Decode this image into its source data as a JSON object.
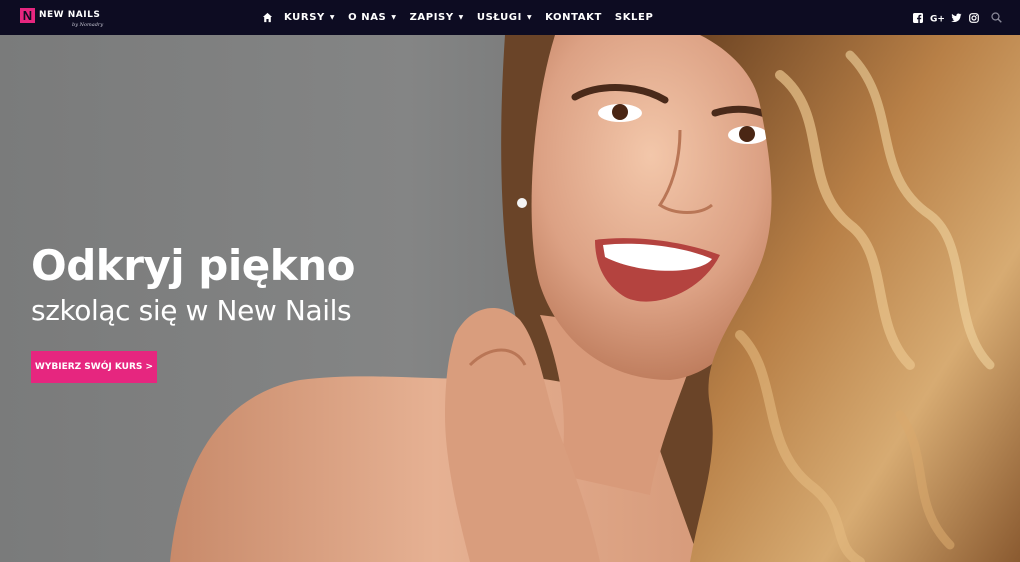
{
  "brand": {
    "logo_letter": "N",
    "name": "NEW NAILS",
    "subtitle": "by Nomadry",
    "accent_color": "#e6267f",
    "nav_background": "#0d0c22"
  },
  "nav": {
    "home_icon": "home-icon",
    "items": [
      {
        "label": "KURSY",
        "dropdown": true
      },
      {
        "label": "O NAS",
        "dropdown": true
      },
      {
        "label": "ZAPISY",
        "dropdown": true
      },
      {
        "label": "USŁUGI",
        "dropdown": true
      },
      {
        "label": "KONTAKT",
        "dropdown": false
      },
      {
        "label": "SKLEP",
        "dropdown": false
      }
    ],
    "caret_glyph": "▼"
  },
  "social_icons": [
    "facebook-icon",
    "google-plus-icon",
    "twitter-icon",
    "instagram-icon",
    "search-icon"
  ],
  "hero": {
    "headline": "Odkryj piękno",
    "subline": "szkoląc się w New Nails",
    "cta_label": "WYBIERZ SWÓJ KURS >",
    "image": "smiling-woman-with-curly-hair-photo"
  }
}
